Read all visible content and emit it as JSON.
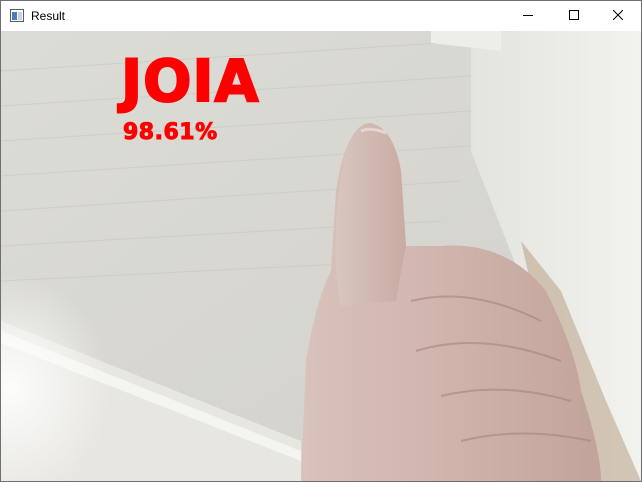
{
  "window": {
    "title": "Result",
    "icon": "app-window-icon",
    "controls": {
      "minimize": "minimize-icon",
      "maximize": "maximize-icon",
      "close": "close-icon"
    }
  },
  "overlay": {
    "label": "JOIA",
    "confidence": "98.61%",
    "color": "#ff0000"
  }
}
